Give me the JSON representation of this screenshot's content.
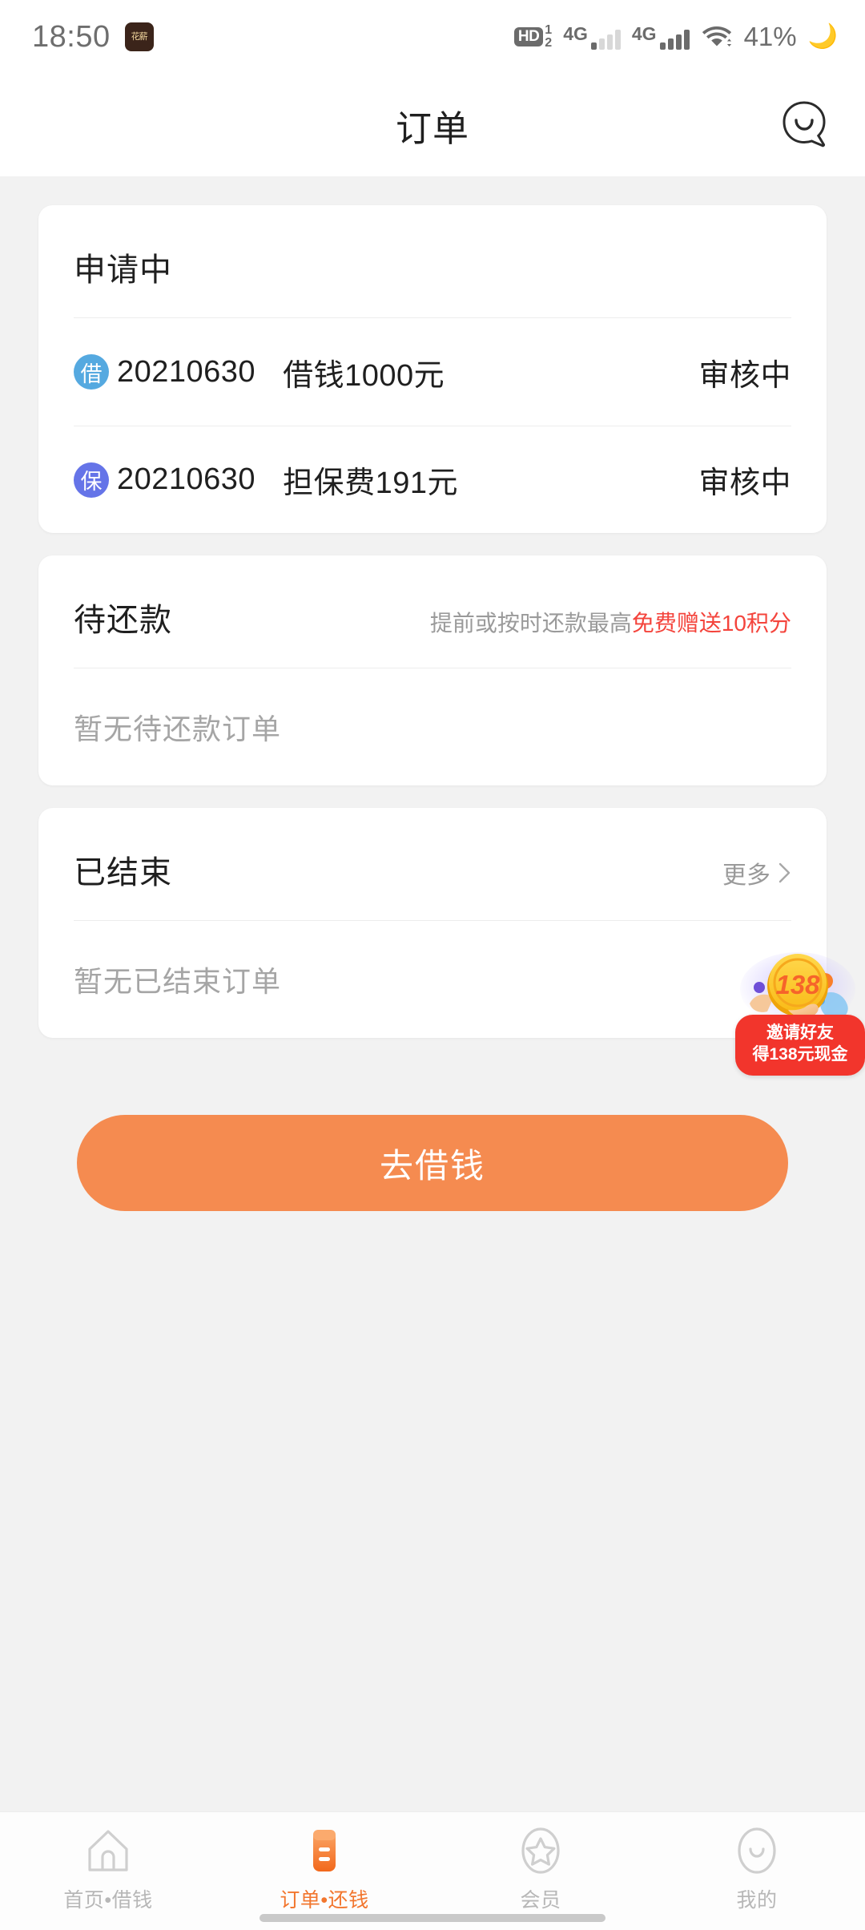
{
  "statusbar": {
    "time": "18:50",
    "app_badge_text": "花薪",
    "hd_label": "HD",
    "sim1_label": "1",
    "sim2_label": "2",
    "net1": "4G",
    "net2": "4G",
    "battery": "41%",
    "moon": "🌙"
  },
  "header": {
    "title": "订单",
    "customer_service_icon": "smiley-chat-icon"
  },
  "cards": {
    "applying": {
      "title": "申请中",
      "rows": [
        {
          "badge": "借",
          "badge_color": "#55a9e0",
          "date": "20210630",
          "desc": "借钱1000元",
          "status": "审核中"
        },
        {
          "badge": "保",
          "badge_color": "#6574e8",
          "date": "20210630",
          "desc": "担保费191元",
          "status": "审核中"
        }
      ]
    },
    "pending": {
      "title": "待还款",
      "note_plain": "提前或按时还款最高",
      "note_highlight": "免费赠送10积分",
      "note_highlight_color": "#f4443c",
      "empty": "暂无待还款订单"
    },
    "finished": {
      "title": "已结束",
      "more_label": "更多",
      "more_icon": "chevron-right-icon",
      "empty": "暂无已结束订单"
    }
  },
  "cta": {
    "label": "去借钱",
    "color": "#f58b50"
  },
  "promo": {
    "coin_amount": "138",
    "line1": "邀请好友",
    "line2": "得138元现金",
    "pill_color": "#f2352c"
  },
  "tabbar": {
    "active_color": "#f2762e",
    "items": [
      {
        "label": "首页•借钱",
        "icon": "home-icon"
      },
      {
        "label": "订单•还钱",
        "icon": "orders-icon"
      },
      {
        "label": "会员",
        "icon": "star-member-icon"
      },
      {
        "label": "我的",
        "icon": "profile-smiley-icon"
      }
    ]
  }
}
